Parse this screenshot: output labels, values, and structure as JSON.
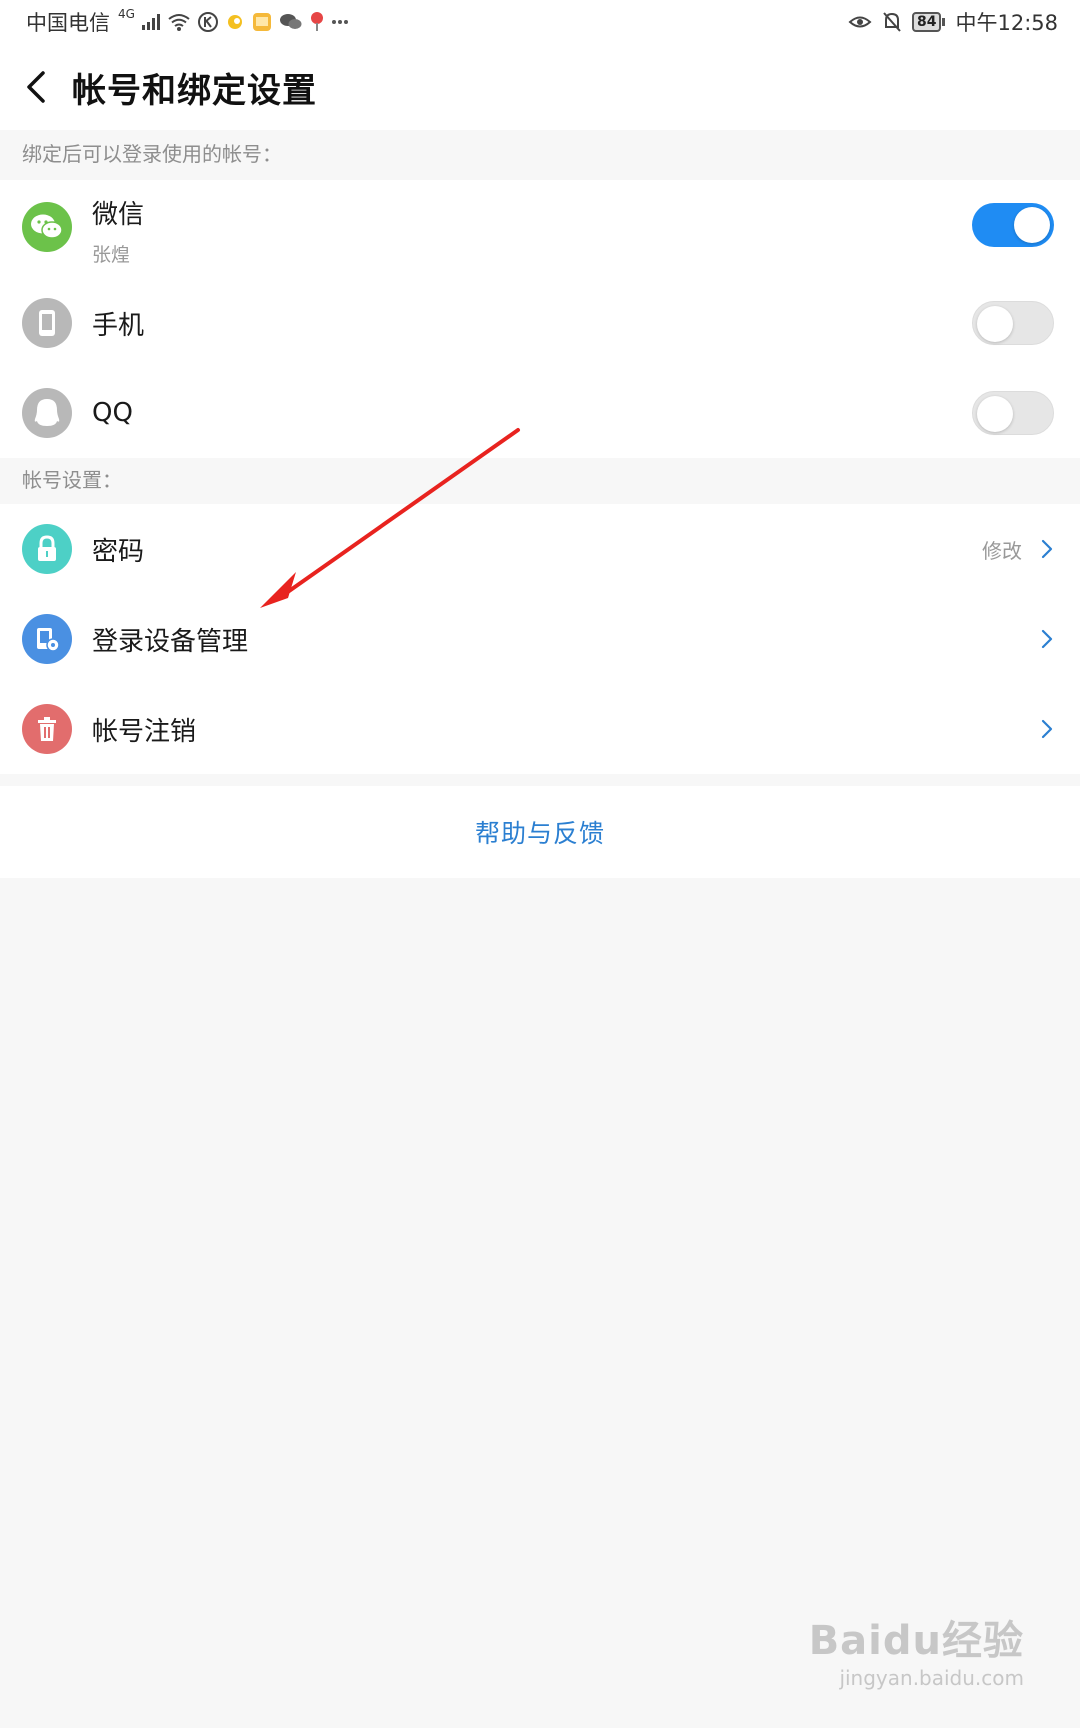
{
  "status_bar": {
    "carrier": "中国电信",
    "network_type": "4G",
    "battery": "84",
    "time": "中午12:58"
  },
  "header": {
    "title": "帐号和绑定设置"
  },
  "bind_section": {
    "label": "绑定后可以登录使用的帐号：",
    "items": [
      {
        "name": "微信",
        "subtitle": "张煌",
        "icon": "wechat-icon",
        "icon_color": "#6cc24a",
        "enabled": true
      },
      {
        "name": "手机",
        "icon": "phone-icon",
        "icon_color": "#b8b8b8",
        "enabled": false
      },
      {
        "name": "QQ",
        "icon": "qq-icon",
        "icon_color": "#b8b8b8",
        "enabled": false
      }
    ]
  },
  "account_section": {
    "label": "帐号设置：",
    "items": [
      {
        "name": "密码",
        "action": "修改",
        "icon": "lock-icon",
        "icon_color": "#4dd0c6"
      },
      {
        "name": "登录设备管理",
        "icon": "device-manage-icon",
        "icon_color": "#4a90e2"
      },
      {
        "name": "帐号注销",
        "icon": "trash-icon",
        "icon_color": "#e26d6d"
      }
    ]
  },
  "help": {
    "label": "帮助与反馈"
  },
  "colors": {
    "accent": "#1f8cf3",
    "link": "#2b7fd1",
    "annotation_arrow": "#e8231f"
  },
  "watermark": {
    "logo": "Baidu经验",
    "url": "jingyan.baidu.com"
  }
}
